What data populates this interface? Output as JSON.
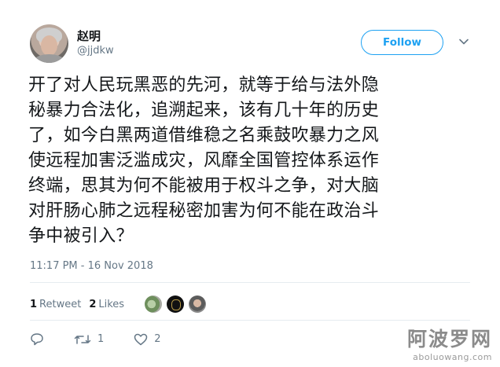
{
  "user": {
    "display_name": "赵明",
    "handle": "@jjdkw"
  },
  "follow_button": {
    "label": "Follow"
  },
  "tweet": {
    "lines": [
      "开了对人民玩黑恶的先河，就等于给与法外隐",
      "秘暴力合法化，追溯起来，该有几十年的历史",
      "了，如今白黑两道借维稳之名乘鼓吹暴力之风",
      "使远程加害泛滥成灾，风靡全国管控体系运作",
      "终端，思其为何不能被用于权斗之争，对大脑",
      "对肝肠心肺之远程秘密加害为何不能在政治斗",
      "争中被引入？"
    ],
    "timestamp": "11:17 PM - 16 Nov 2018"
  },
  "stats": {
    "retweets_count": "1",
    "retweets_label": "Retweet",
    "likes_count": "2",
    "likes_label": "Likes"
  },
  "actions": {
    "reply_icon": "reply-icon",
    "retweet_icon": "retweet-icon",
    "retweet_count": "1",
    "like_icon": "heart-icon",
    "like_count": "2"
  },
  "watermark": {
    "title": "阿波罗网",
    "url": "aboluowang.com"
  },
  "colors": {
    "accent": "#1da1f2",
    "muted": "#657786",
    "text": "#14171a"
  }
}
